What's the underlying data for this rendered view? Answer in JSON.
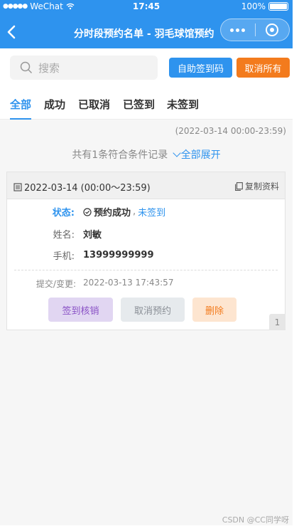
{
  "status_bar": {
    "carrier": "WeChat",
    "time": "17:45",
    "battery": "100%"
  },
  "nav": {
    "title": "分时段预约名单 - 羽毛球馆预约",
    "back_icon": "chevron-left-icon",
    "more_icon": "more-dots-icon",
    "close_icon": "target-circle-icon"
  },
  "toolbar": {
    "search_placeholder": "搜索",
    "checkin_code_label": "自助签到码",
    "cancel_all_label": "取消所有"
  },
  "tabs": [
    {
      "label": "全部",
      "active": true
    },
    {
      "label": "成功",
      "active": false
    },
    {
      "label": "已取消",
      "active": false
    },
    {
      "label": "已签到",
      "active": false
    },
    {
      "label": "未签到",
      "active": false
    }
  ],
  "filter": {
    "range": "(2022-03-14 00:00-23:59)",
    "summary": "共有1条符合条件记录",
    "expand_label": "全部展开"
  },
  "record": {
    "date": "2022-03-14 (00:00～23:59)",
    "copy_label": "复制资料",
    "status_label": "状态:",
    "status_value": "预约成功",
    "status_sep": ",",
    "status_checkin": "未签到",
    "name_label": "姓名:",
    "name_value": "刘敏",
    "phone_label": "手机:",
    "phone_value": "13999999999",
    "submit_label": "提交/变更:",
    "submit_value": "2022-03-13 17:43:57",
    "checkin_button": "签到核销",
    "cancel_button": "取消预约",
    "delete_button": "删除",
    "index": "1"
  },
  "colors": {
    "primary": "#2e93ee",
    "orange": "#f37b1d",
    "purple": "#8a52c6"
  },
  "watermark": "CSDN @CC同学呀"
}
